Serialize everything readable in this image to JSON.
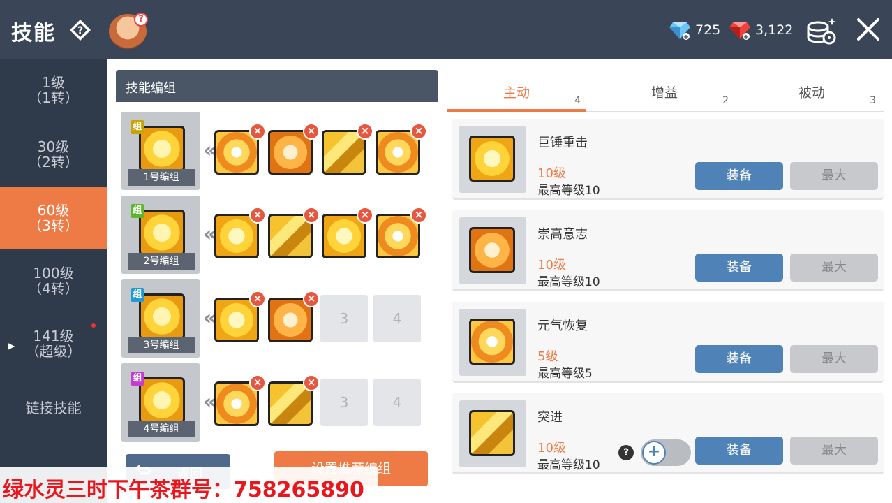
{
  "header": {
    "title": "技能",
    "blue_gems": "725",
    "red_gems": "3,122"
  },
  "sidebar": {
    "items": [
      {
        "line1": "1级",
        "line2": "（1转）"
      },
      {
        "line1": "30级",
        "line2": "（2转）"
      },
      {
        "line1": "60级",
        "line2": "（3转）"
      },
      {
        "line1": "100级",
        "line2": "（4转）"
      },
      {
        "line1": "141级",
        "line2": "（超级）"
      },
      {
        "line1": "链接技能",
        "line2": ""
      }
    ]
  },
  "groups": {
    "header": "技能编组",
    "tag": "组",
    "rows": [
      {
        "label": "1号编组",
        "tag_color": "#c9a400"
      },
      {
        "label": "2号编组",
        "tag_color": "#5cb82a"
      },
      {
        "label": "3号编组",
        "tag_color": "#1e9ad6"
      },
      {
        "label": "4号编组",
        "tag_color": "#c63ad0"
      }
    ],
    "empty_slots": {
      "three": "3",
      "four": "4"
    },
    "return_label": "返回",
    "recommend_label": "设置推荐编组"
  },
  "tabs": [
    {
      "label": "主动",
      "count": "4"
    },
    {
      "label": "增益",
      "count": "2"
    },
    {
      "label": "被动",
      "count": "3"
    }
  ],
  "skills": [
    {
      "name": "巨锤重击",
      "level": "10级",
      "max_level": "最高等级10"
    },
    {
      "name": "崇高意志",
      "level": "10级",
      "max_level": "最高等级10"
    },
    {
      "name": "元气恢复",
      "level": "5级",
      "max_level": "最高等级5"
    },
    {
      "name": "突进",
      "level": "10级",
      "max_level": "最高等级10"
    }
  ],
  "buttons": {
    "equip": "装备",
    "max": "最大"
  },
  "watermark": "绿水灵三时下午茶群号：758265890"
}
